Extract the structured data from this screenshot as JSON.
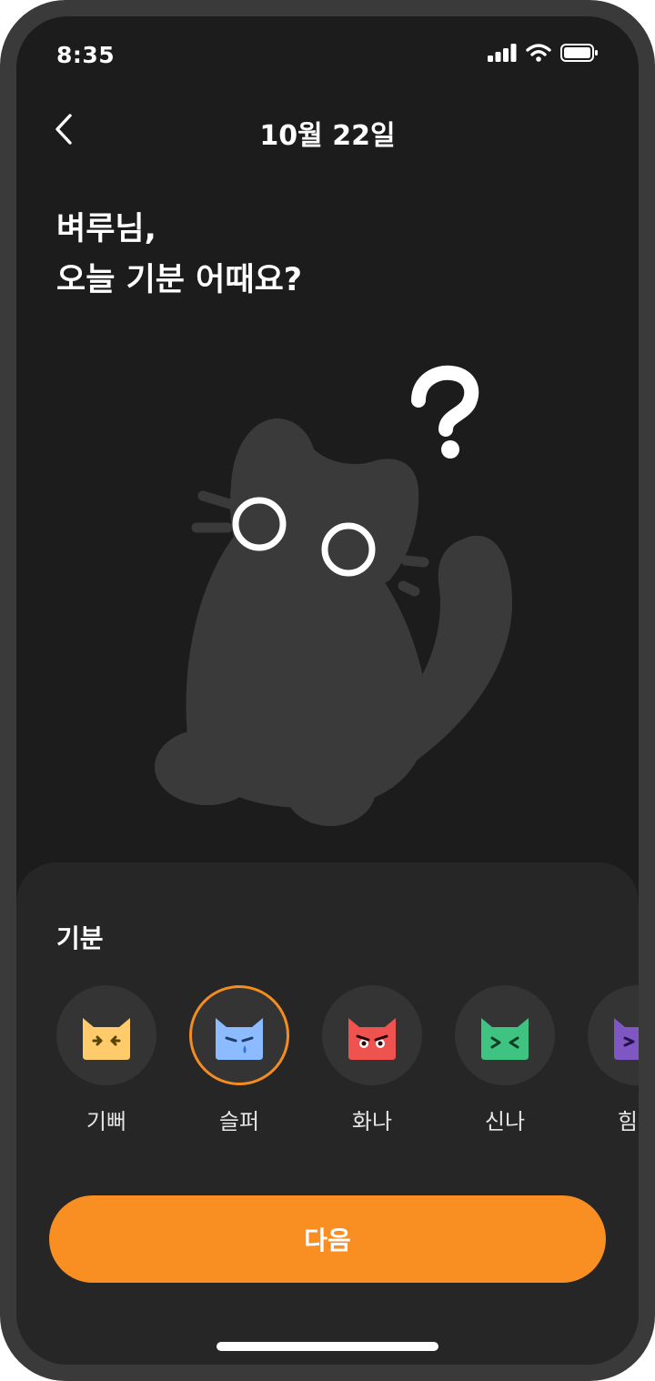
{
  "status_bar": {
    "time": "8:35"
  },
  "header": {
    "title": "10월 22일"
  },
  "prompt": {
    "line1": "벼루님,",
    "line2": "오늘 기분 어때요?"
  },
  "illustration": {
    "mark": "?"
  },
  "mood_sheet": {
    "title": "기분",
    "selected": "슬퍼",
    "moods": [
      {
        "label": "기뻐",
        "color": "#ffcb6b",
        "icon": "happy-cat-icon"
      },
      {
        "label": "슬퍼",
        "color": "#8cbcff",
        "icon": "sad-cat-icon"
      },
      {
        "label": "화나",
        "color": "#ef5350",
        "icon": "angry-cat-icon"
      },
      {
        "label": "신나",
        "color": "#3ec480",
        "icon": "excited-cat-icon"
      },
      {
        "label": "힘들",
        "color": "#7e57c2",
        "icon": "tired-cat-icon"
      }
    ]
  },
  "next_button": {
    "label": "다음"
  },
  "colors": {
    "accent": "#f98e22",
    "background": "#1c1c1c",
    "sheet": "#262626"
  }
}
